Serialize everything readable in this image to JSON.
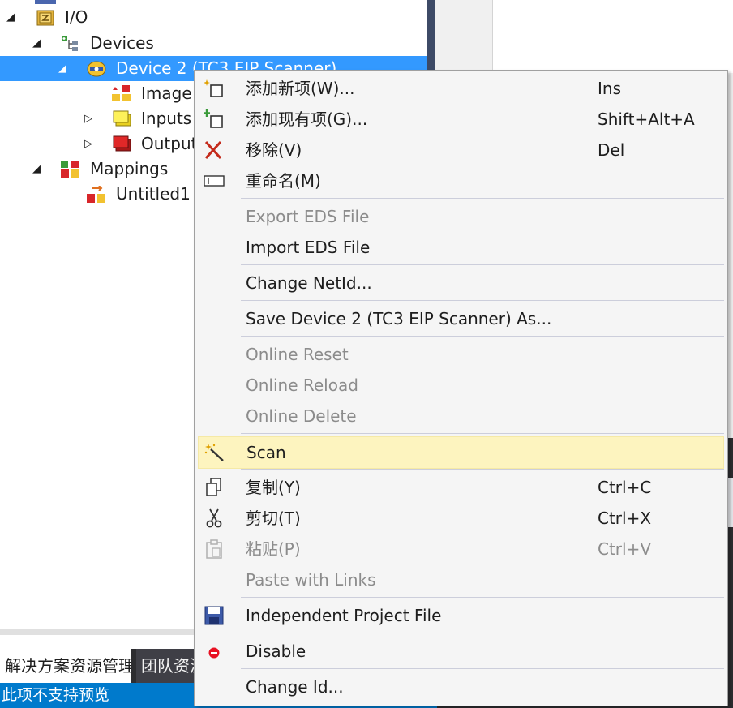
{
  "tree": {
    "items": [
      {
        "label": "I/O",
        "expander": "◢",
        "icon": "io-folder-icon"
      },
      {
        "label": "Devices",
        "expander": "◢",
        "icon": "devices-tree-icon"
      },
      {
        "label": "Device 2 (TC3 EIP Scanner)",
        "expander": "◢",
        "icon": "eip-scanner-device-icon"
      },
      {
        "label": "Image",
        "expander": "",
        "icon": "image-icon"
      },
      {
        "label": "Inputs",
        "expander": "▷",
        "icon": "inputs-icon"
      },
      {
        "label": "Outputs",
        "expander": "▷",
        "icon": "outputs-icon"
      },
      {
        "label": "Mappings",
        "expander": "◢",
        "icon": "mappings-icon"
      },
      {
        "label": "Untitled1",
        "expander": "",
        "icon": "mapping-entry-icon"
      }
    ]
  },
  "bottom": {
    "tab_active": "解决方案资源管理器",
    "tab_inactive": "团队资源管理器",
    "status_text": "此项不支持预览"
  },
  "context_menu": {
    "items": [
      {
        "label": "添加新项(W)...",
        "shortcut": "Ins",
        "icon": "add-new-item-icon"
      },
      {
        "label": "添加现有项(G)...",
        "shortcut": "Shift+Alt+A",
        "icon": "add-existing-item-icon"
      },
      {
        "label": "移除(V)",
        "shortcut": "Del",
        "icon": "remove-icon"
      },
      {
        "label": "重命名(M)",
        "shortcut": "",
        "icon": "rename-icon"
      },
      {
        "label": "Export EDS File",
        "shortcut": "",
        "disabled": true
      },
      {
        "label": "Import EDS File",
        "shortcut": ""
      },
      {
        "label": "Change NetId...",
        "shortcut": ""
      },
      {
        "label": "Save Device 2 (TC3 EIP Scanner) As...",
        "shortcut": ""
      },
      {
        "label": "Online Reset",
        "shortcut": "",
        "disabled": true
      },
      {
        "label": "Online Reload",
        "shortcut": "",
        "disabled": true
      },
      {
        "label": "Online Delete",
        "shortcut": "",
        "disabled": true
      },
      {
        "label": "Scan",
        "shortcut": "",
        "icon": "scan-wand-icon",
        "highlighted": true
      },
      {
        "label": "复制(Y)",
        "shortcut": "Ctrl+C",
        "icon": "copy-icon"
      },
      {
        "label": "剪切(T)",
        "shortcut": "Ctrl+X",
        "icon": "cut-icon"
      },
      {
        "label": "粘贴(P)",
        "shortcut": "Ctrl+V",
        "icon": "paste-icon",
        "disabled": true
      },
      {
        "label": "Paste with Links",
        "shortcut": "",
        "disabled": true
      },
      {
        "label": "Independent Project File",
        "shortcut": "",
        "icon": "save-disk-icon"
      },
      {
        "label": "Disable",
        "shortcut": "",
        "icon": "disable-icon"
      },
      {
        "label": "Change Id...",
        "shortcut": ""
      }
    ]
  },
  "colors": {
    "selection": "#3399ff",
    "menu_background": "#f5f5f5",
    "menu_highlight": "#fdf4bf",
    "disabled_text": "#8c8c8c",
    "status_bar": "#007acc"
  }
}
